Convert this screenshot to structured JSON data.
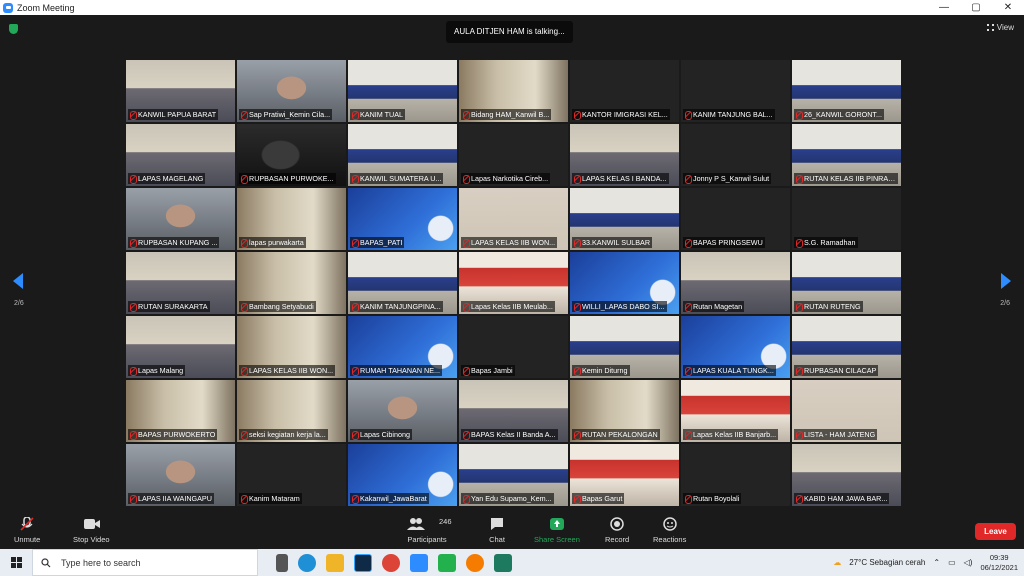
{
  "window": {
    "title": "Zoom Meeting",
    "controls": [
      "—",
      "▢",
      "✕"
    ]
  },
  "banner": {
    "talking": "AULA DITJEN HAM is talking..."
  },
  "view_label": "View",
  "pager": {
    "left": "2/6",
    "right": "2/6"
  },
  "participants": [
    {
      "name": "KANWIL PAPUA BARAT",
      "scene": "room"
    },
    {
      "name": "Sap Pratiwi_Kemin Cila...",
      "scene": "person"
    },
    {
      "name": "KANIM TUAL",
      "scene": "hall"
    },
    {
      "name": "Bidang HAM_Kanwil B...",
      "scene": "office"
    },
    {
      "name": "KANTOR IMIGRASI KEL...",
      "scene": "blank"
    },
    {
      "name": "KANIM TANJUNG BAL...",
      "scene": "blank"
    },
    {
      "name": "26_KANWIL GORONT...",
      "scene": "hall"
    },
    {
      "name": "LAPAS MAGELANG",
      "scene": "room"
    },
    {
      "name": "RUPBASAN PURWOKE...",
      "scene": "dark"
    },
    {
      "name": "KANWIL SUMATERA U...",
      "scene": "hall"
    },
    {
      "name": "Lapas Narkotika Cireb...",
      "scene": "blank"
    },
    {
      "name": "LAPAS KELAS I BANDA...",
      "scene": "room"
    },
    {
      "name": "Jonny P S_Kanwil Sulut",
      "scene": "blank"
    },
    {
      "name": "RUTAN KELAS IIB PINRANG",
      "scene": "hall"
    },
    {
      "name": "RUPBASAN KUPANG ...",
      "scene": "person"
    },
    {
      "name": "lapas purwakarta",
      "scene": "office"
    },
    {
      "name": "BAPAS_PATI",
      "scene": "slide"
    },
    {
      "name": "LAPAS KELAS IIB WON...",
      "scene": "wall"
    },
    {
      "name": "33.KANWIL SULBAR",
      "scene": "hall"
    },
    {
      "name": "BAPAS PRINGSEWU",
      "scene": "blank"
    },
    {
      "name": "S.G. Ramadhan",
      "scene": "blank"
    },
    {
      "name": "RUTAN SURAKARTA",
      "scene": "room"
    },
    {
      "name": "Bambang Setyabudi",
      "scene": "office"
    },
    {
      "name": "KANIM TANJUNGPINA...",
      "scene": "hall"
    },
    {
      "name": "Lapas Kelas IIB Meulab...",
      "scene": "banner"
    },
    {
      "name": "WILLI_LAPAS DABO SI...",
      "scene": "slide"
    },
    {
      "name": "Rutan Magetan",
      "scene": "room"
    },
    {
      "name": "RUTAN RUTENG",
      "scene": "hall"
    },
    {
      "name": "Lapas Malang",
      "scene": "room"
    },
    {
      "name": "LAPAS KELAS IIB WON...",
      "scene": "office"
    },
    {
      "name": "RUMAH TAHANAN NE...",
      "scene": "slide"
    },
    {
      "name": "Bapas Jambi",
      "scene": "blank"
    },
    {
      "name": "Kemin Diturng",
      "scene": "hall"
    },
    {
      "name": "LAPAS KUALA TUNGK...",
      "scene": "slide"
    },
    {
      "name": "RUPBASAN CILACAP",
      "scene": "hall"
    },
    {
      "name": "BAPAS PURWOKERTO",
      "scene": "office"
    },
    {
      "name": "seksi kegiatan kerja la...",
      "scene": "office"
    },
    {
      "name": "Lapas Cibinong",
      "scene": "person"
    },
    {
      "name": "BAPAS Kelas II Banda A...",
      "scene": "room"
    },
    {
      "name": "RUTAN PEKALONGAN",
      "scene": "office"
    },
    {
      "name": "Lapas Kelas IIB Banjarb...",
      "scene": "banner"
    },
    {
      "name": "LISTA - HAM JATENG",
      "scene": "wall"
    },
    {
      "name": "LAPAS IIA WAINGAPU",
      "scene": "person"
    },
    {
      "name": "Kanim Mataram",
      "scene": "blank"
    },
    {
      "name": "Kakanwil_JawaBarat",
      "scene": "slide"
    },
    {
      "name": "Yan Edu Supamo_Kem...",
      "scene": "hall"
    },
    {
      "name": "Bapas Garut",
      "scene": "banner"
    },
    {
      "name": "Rutan Boyolali",
      "scene": "blank"
    },
    {
      "name": "KABID HAM JAWA BAR...",
      "scene": "room"
    }
  ],
  "toolbar": {
    "unmute": "Unmute",
    "stop_video": "Stop Video",
    "participants_count": "246",
    "participants": "Participants",
    "chat": "Chat",
    "share_screen": "Share Screen",
    "record": "Record",
    "reactions": "Reactions",
    "leave": "Leave"
  },
  "taskbar": {
    "search_placeholder": "Type here to search",
    "weather": "27°C  Sebagian cerah",
    "time": "09:39",
    "date": "06/12/2021"
  },
  "colors": {
    "accent": "#2d8cff",
    "share_green": "#23a85a",
    "leave_red": "#e02828"
  }
}
